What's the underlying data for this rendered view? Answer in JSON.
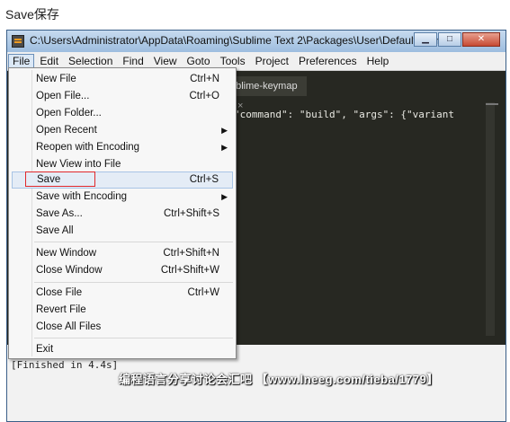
{
  "caption": "Save保存",
  "window": {
    "title": "C:\\Users\\Administrator\\AppData\\Roaming\\Sublime Text 2\\Packages\\User\\Default (Win..."
  },
  "menubar": {
    "items": [
      "File",
      "Edit",
      "Selection",
      "Find",
      "View",
      "Goto",
      "Tools",
      "Project",
      "Preferences",
      "Help"
    ]
  },
  "tab": {
    "label": "ublime-keymap",
    "close": "×"
  },
  "editor": {
    "code": "\"command\": \"build\", \"args\": {\"variant"
  },
  "panel": {
    "output": "[Finished in 4.4s]"
  },
  "watermark": "编程语言分享讨论会汇吧 【www.lneeg.com/tieba/1779】",
  "file_menu": {
    "items": [
      {
        "label": "New File",
        "shortcut": "Ctrl+N"
      },
      {
        "label": "Open File...",
        "shortcut": "Ctrl+O"
      },
      {
        "label": "Open Folder...",
        "shortcut": ""
      },
      {
        "label": "Open Recent",
        "shortcut": "",
        "submenu": true
      },
      {
        "label": "Reopen with Encoding",
        "shortcut": "",
        "submenu": true
      },
      {
        "label": "New View into File",
        "shortcut": ""
      },
      {
        "label": "Save",
        "shortcut": "Ctrl+S"
      },
      {
        "label": "Save with Encoding",
        "shortcut": "",
        "submenu": true
      },
      {
        "label": "Save As...",
        "shortcut": "Ctrl+Shift+S"
      },
      {
        "label": "Save All",
        "shortcut": ""
      },
      {
        "label": "New Window",
        "shortcut": "Ctrl+Shift+N"
      },
      {
        "label": "Close Window",
        "shortcut": "Ctrl+Shift+W"
      },
      {
        "label": "Close File",
        "shortcut": "Ctrl+W"
      },
      {
        "label": "Revert File",
        "shortcut": ""
      },
      {
        "label": "Close All Files",
        "shortcut": ""
      },
      {
        "label": "Exit",
        "shortcut": ""
      }
    ],
    "highlighted": "Save"
  },
  "colors": {
    "editor_bg": "#272822",
    "highlight_box": "#e0282b",
    "titlebar": "#9dbddf"
  }
}
